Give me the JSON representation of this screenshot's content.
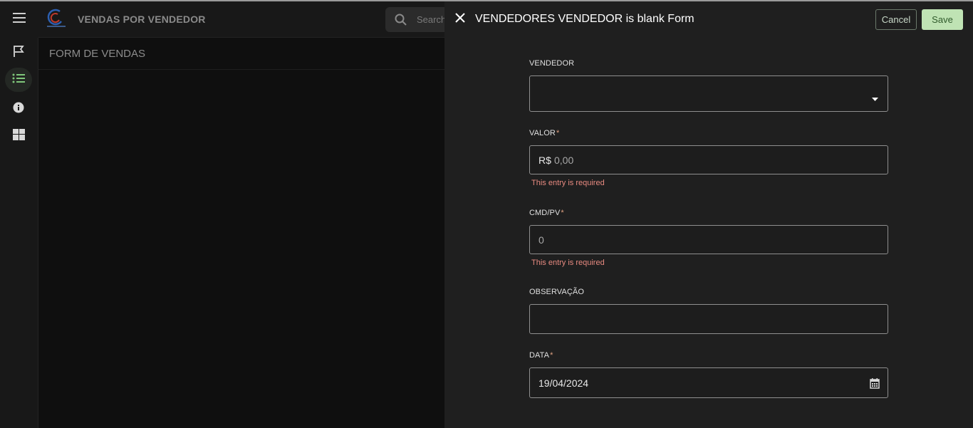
{
  "app": {
    "title": "VENDAS POR VENDEDOR",
    "search_placeholder": "Search",
    "subtitle": "FORM DE VENDAS"
  },
  "rail": {
    "items": [
      "flag-icon",
      "list-icon",
      "info-icon",
      "grid-icon"
    ],
    "active": "list-icon"
  },
  "panel": {
    "title": "VENDEDORES VENDEDOR is blank Form",
    "cancel_label": "Cancel",
    "save_label": "Save"
  },
  "form": {
    "vendedor": {
      "label": "VENDEDOR",
      "value": ""
    },
    "valor": {
      "label": "VALOR",
      "required_mark": "*",
      "prefix": "R$",
      "placeholder": "0,00",
      "error": "This entry is required"
    },
    "cmd_pv": {
      "label": "CMD/PV",
      "required_mark": "*",
      "placeholder": "0",
      "error": "This entry is required"
    },
    "observacao": {
      "label": "OBSERVAÇÃO",
      "value": ""
    },
    "data": {
      "label": "DATA",
      "required_mark": "*",
      "value": "19/04/2024"
    }
  },
  "colors": {
    "accent": "#bfe3b4",
    "error": "#e88a80",
    "panel_bg": "#1f1f1f"
  }
}
